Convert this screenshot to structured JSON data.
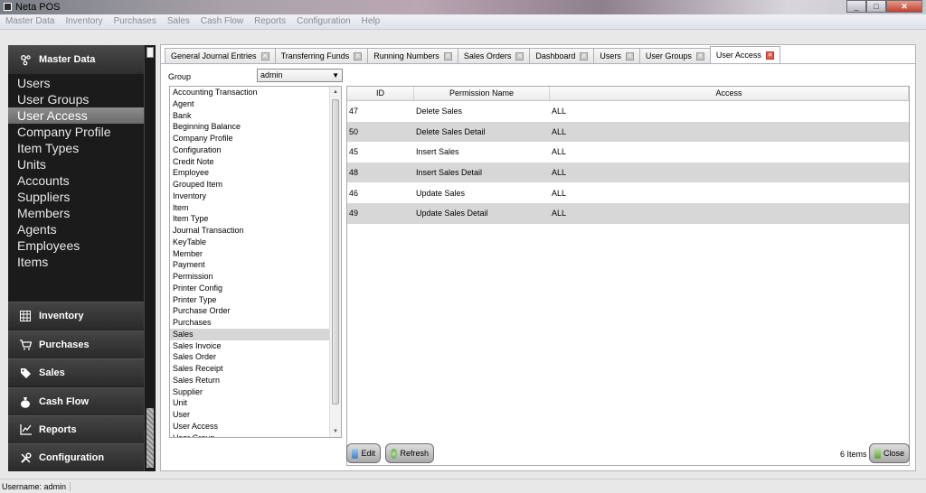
{
  "window": {
    "title": "Neta POS",
    "min": "_",
    "max": "□",
    "close": "✕"
  },
  "menubar": [
    "Master Data",
    "Inventory",
    "Purchases",
    "Sales",
    "Cash Flow",
    "Reports",
    "Configuration",
    "Help"
  ],
  "sidebar": {
    "header": "Master Data",
    "items": [
      "Users",
      "User Groups",
      "User Access",
      "Company Profile",
      "Item Types",
      "Units",
      "Accounts",
      "Suppliers",
      "Members",
      "Agents",
      "Employees",
      "Items"
    ],
    "active_index": 2,
    "groups": [
      "Inventory",
      "Purchases",
      "Sales",
      "Cash Flow",
      "Reports",
      "Configuration"
    ]
  },
  "tabs": [
    {
      "label": "General Journal Entries"
    },
    {
      "label": "Transferring Funds"
    },
    {
      "label": "Running Numbers"
    },
    {
      "label": "Sales Orders"
    },
    {
      "label": "Dashboard"
    },
    {
      "label": "Users"
    },
    {
      "label": "User Groups"
    },
    {
      "label": "User Access",
      "active": true
    }
  ],
  "group": {
    "label": "Group",
    "value": "admin"
  },
  "modules": [
    "Accounting Transaction",
    "Agent",
    "Bank",
    "Beginning Balance",
    "Company Profile",
    "Configuration",
    "Credit Note",
    "Employee",
    "Grouped Item",
    "Inventory",
    "Item",
    "Item Type",
    "Journal Transaction",
    "KeyTable",
    "Member",
    "Payment",
    "Permission",
    "Printer Config",
    "Printer Type",
    "Purchase Order",
    "Purchases",
    "Sales",
    "Sales Invoice",
    "Sales Order",
    "Sales Receipt",
    "Sales Return",
    "Supplier",
    "Unit",
    "User",
    "User Access",
    "User Group"
  ],
  "selected_module": "Sales",
  "grid": {
    "columns": [
      "ID",
      "Permission Name",
      "Access"
    ],
    "rows": [
      [
        "47",
        "Delete Sales",
        "ALL"
      ],
      [
        "50",
        "Delete Sales Detail",
        "ALL"
      ],
      [
        "45",
        "Insert Sales",
        "ALL"
      ],
      [
        "48",
        "Insert Sales Detail",
        "ALL"
      ],
      [
        "46",
        "Update Sales",
        "ALL"
      ],
      [
        "49",
        "Update Sales Detail",
        "ALL"
      ]
    ]
  },
  "buttons": {
    "edit": "Edit",
    "refresh": "Refresh",
    "close": "Close"
  },
  "items_count": "6 Items",
  "status": "Username: admin"
}
